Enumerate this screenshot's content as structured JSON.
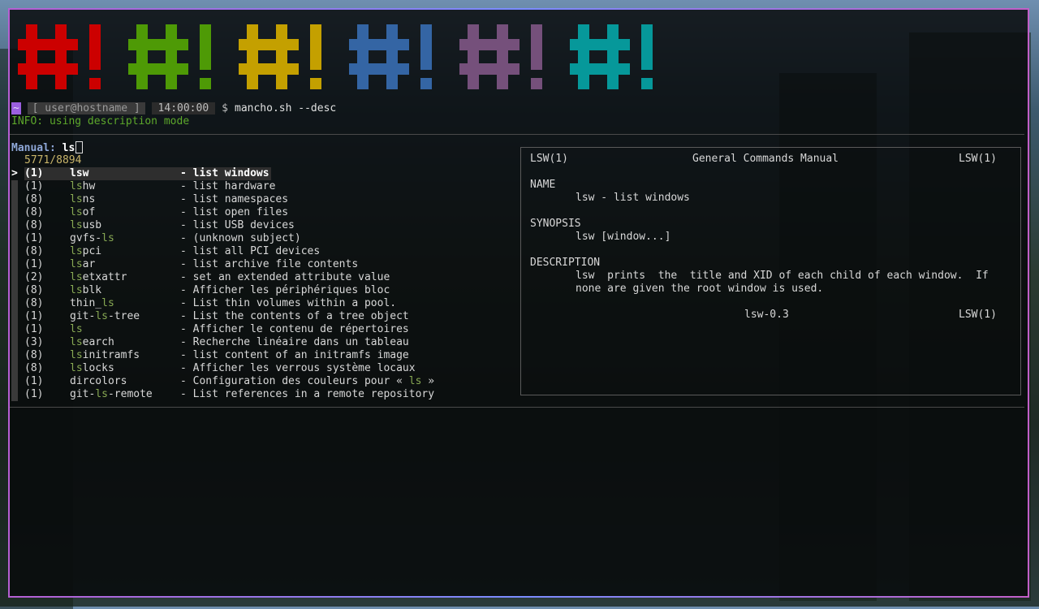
{
  "logo": {
    "glyphs": [
      {
        "text": "#!",
        "color": "#cc0000"
      },
      {
        "text": "#!",
        "color": "#4e9a06"
      },
      {
        "text": "#!",
        "color": "#c4a000"
      },
      {
        "text": "#!",
        "color": "#3465a4"
      },
      {
        "text": "#!",
        "color": "#75507b"
      },
      {
        "text": "#!",
        "color": "#06989a"
      }
    ]
  },
  "prompt": {
    "tilde": "~",
    "userhost": "[ user@hostname ]",
    "time": "14:00:00",
    "dollar": "$",
    "command": "mancho.sh --desc"
  },
  "info": "INFO: using description mode",
  "search": {
    "label": "Manual:",
    "query": "ls",
    "count": "5771/8894"
  },
  "results": [
    {
      "section": "(1)",
      "name": [
        "",
        "ls",
        "w"
      ],
      "desc": [
        "- list windows"
      ],
      "selected": true
    },
    {
      "section": "(1)",
      "name": [
        "",
        "ls",
        "hw"
      ],
      "desc": [
        "- list hardware"
      ]
    },
    {
      "section": "(8)",
      "name": [
        "",
        "ls",
        "ns"
      ],
      "desc": [
        "- list namespaces"
      ]
    },
    {
      "section": "(8)",
      "name": [
        "",
        "ls",
        "of"
      ],
      "desc": [
        "- list open files"
      ]
    },
    {
      "section": "(8)",
      "name": [
        "",
        "ls",
        "usb"
      ],
      "desc": [
        "- list USB devices"
      ]
    },
    {
      "section": "(1)",
      "name": [
        "gvfs-",
        "ls",
        ""
      ],
      "desc": [
        "- (unknown subject)"
      ]
    },
    {
      "section": "(8)",
      "name": [
        "",
        "ls",
        "pci"
      ],
      "desc": [
        "- list all PCI devices"
      ]
    },
    {
      "section": "(1)",
      "name": [
        "",
        "ls",
        "ar"
      ],
      "desc": [
        "- list archive file contents"
      ]
    },
    {
      "section": "(2)",
      "name": [
        "",
        "ls",
        "etxattr"
      ],
      "desc": [
        "- set an extended attribute value"
      ]
    },
    {
      "section": "(8)",
      "name": [
        "",
        "ls",
        "blk"
      ],
      "desc": [
        "- Afficher les périphériques bloc"
      ]
    },
    {
      "section": "(8)",
      "name": [
        "thin_",
        "ls",
        ""
      ],
      "desc": [
        "- List thin volumes within a pool."
      ]
    },
    {
      "section": "(1)",
      "name": [
        "git-",
        "ls",
        "-tree"
      ],
      "desc": [
        "- List the contents of a tree object"
      ]
    },
    {
      "section": "(1)",
      "name": [
        "",
        "ls",
        ""
      ],
      "desc": [
        "- Afficher le contenu de répertoires"
      ]
    },
    {
      "section": "(3)",
      "name": [
        "",
        "ls",
        "earch"
      ],
      "desc": [
        "- Recherche linéaire dans un tableau"
      ]
    },
    {
      "section": "(8)",
      "name": [
        "",
        "ls",
        "initramfs"
      ],
      "desc": [
        "- list content of an initramfs image"
      ]
    },
    {
      "section": "(8)",
      "name": [
        "",
        "ls",
        "locks"
      ],
      "desc": [
        "- Afficher les verrous système locaux"
      ]
    },
    {
      "section": "(1)",
      "name": [
        "dircolors",
        "",
        ""
      ],
      "desc": [
        "- Configuration des couleurs pour « ",
        "ls",
        " »"
      ]
    },
    {
      "section": "(1)",
      "name": [
        "git-",
        "ls",
        "-remote"
      ],
      "desc": [
        "- List references in a remote repository"
      ]
    }
  ],
  "preview": {
    "header_left": "LSW(1)",
    "header_center": "General Commands Manual",
    "header_right": "LSW(1)",
    "name_heading": "NAME",
    "name_text": "lsw - list windows",
    "synopsis_heading": "SYNOPSIS",
    "synopsis_text": "lsw [window...]",
    "description_heading": "DESCRIPTION",
    "description_line1": "lsw  prints  the  title and XID of each child of each window.  If",
    "description_line2": "none are given the root window is used.",
    "footer_center": "lsw-0.3",
    "footer_right": "LSW(1)"
  }
}
